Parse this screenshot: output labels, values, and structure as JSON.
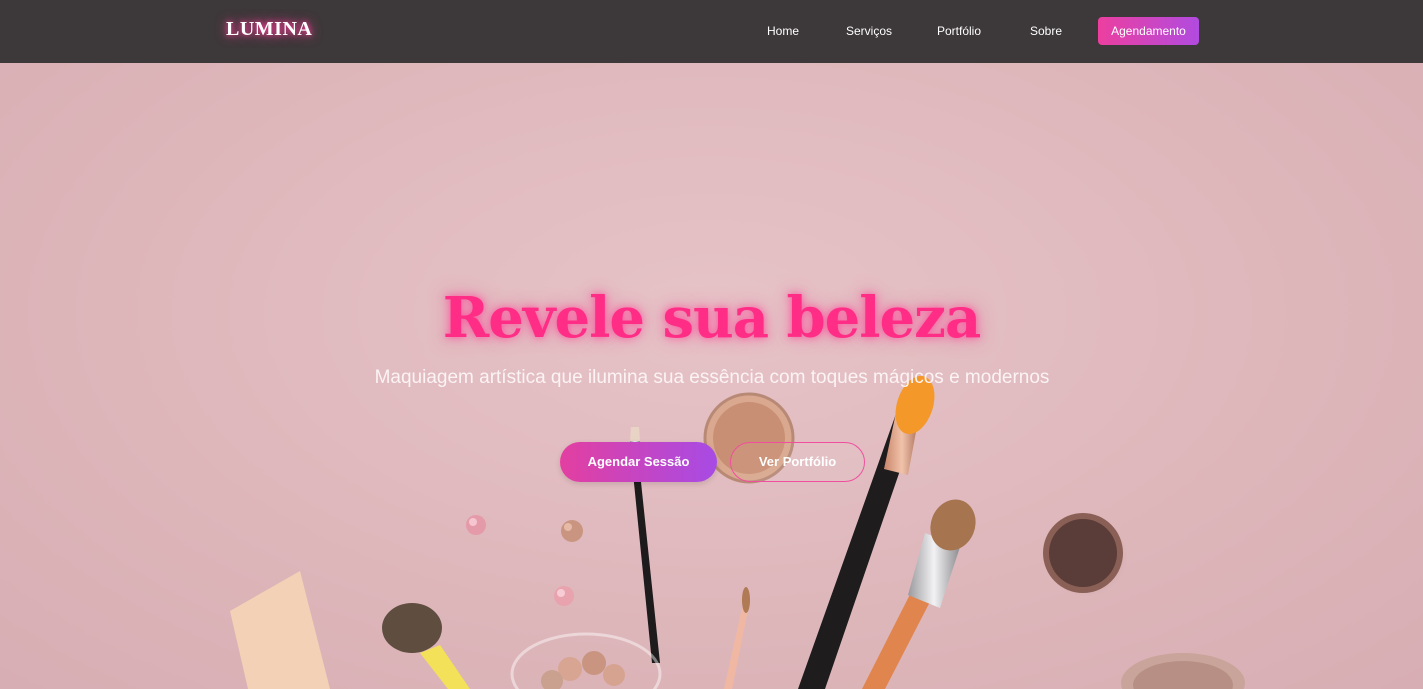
{
  "nav": {
    "brand": "LUMINA",
    "links": [
      "Home",
      "Serviços",
      "Portfólio",
      "Sobre"
    ],
    "cta": "Agendamento"
  },
  "hero": {
    "title": "Revele sua beleza",
    "subtitle": "Maquiagem artística que ilumina sua essência com toques mágicos e modernos",
    "primary_button": "Agendar Sessão",
    "secondary_button": "Ver Portfólio"
  },
  "colors": {
    "accent_pink": "#ff2d86",
    "gradient_start": "#ec3f9f",
    "gradient_end": "#b14be0",
    "navbar_bg": "#3d3839",
    "hero_bg": "#e7c4c8"
  },
  "icons": {
    "hero_image": "makeup-brushes-image"
  }
}
